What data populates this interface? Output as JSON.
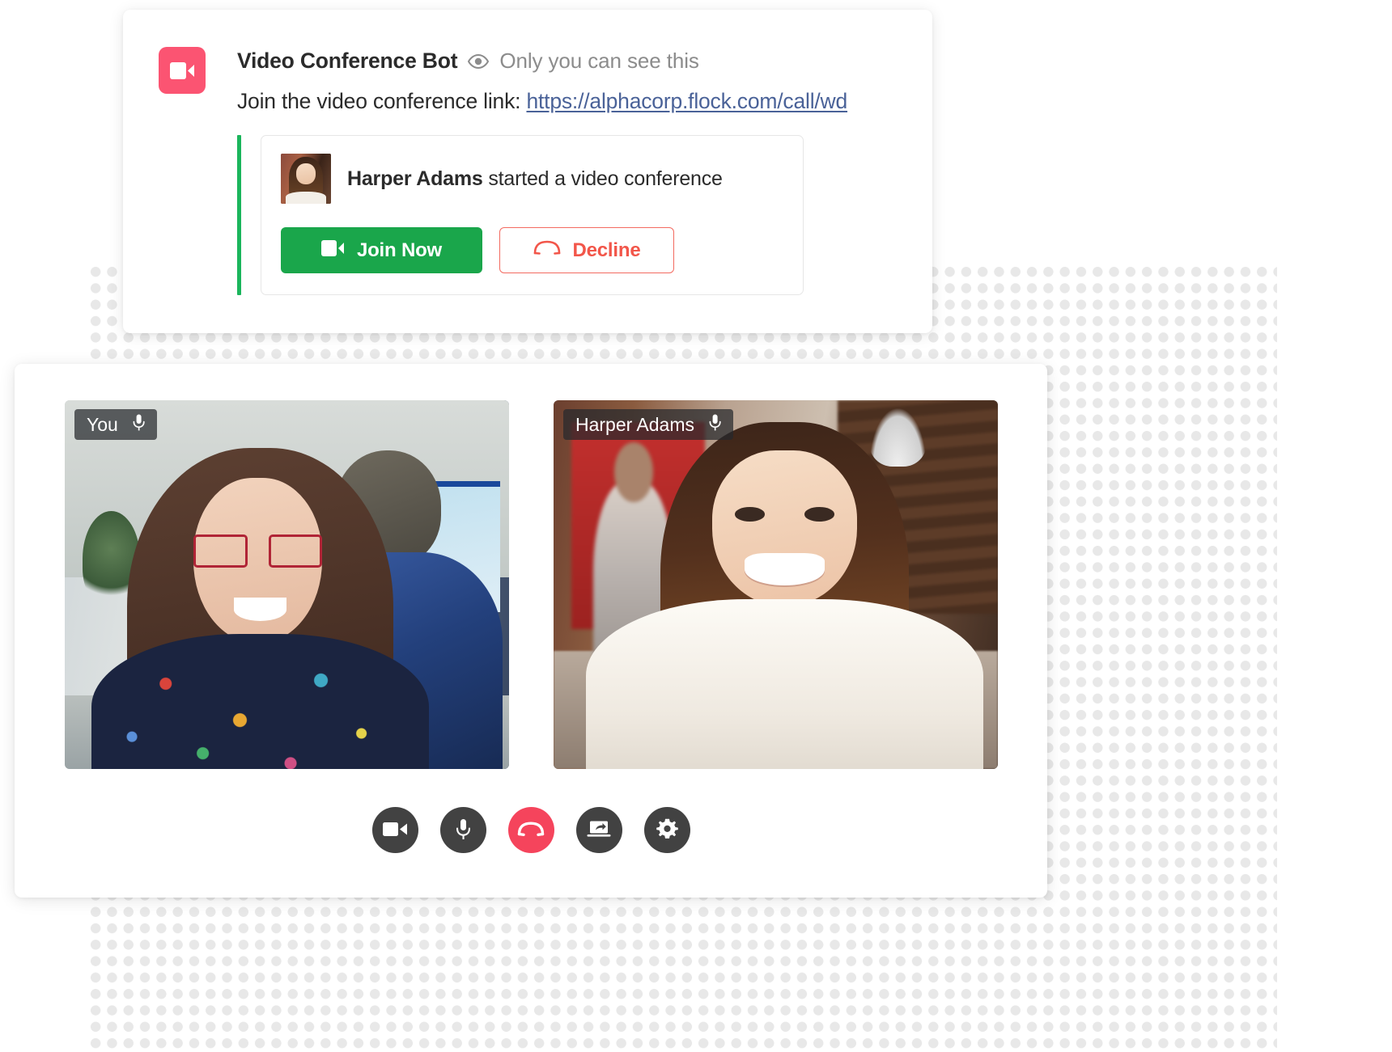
{
  "message_card": {
    "bot_avatar_icon": "video-camera-icon",
    "bot_name": "Video Conference Bot",
    "visibility_icon": "eye-icon",
    "visibility_note": "Only you can see this",
    "join_prefix": "Join the video conference link: ",
    "join_link_text": "https://alphacorp.flock.com/call/wd",
    "accent_bar_color": "#1bb55c",
    "bot_avatar_color": "#fb5472",
    "link_color": "#4a6298"
  },
  "invite": {
    "avatar_name": "harper-adams-thumbnail",
    "actor": "Harper Adams",
    "action": " started a video conference",
    "join_button": {
      "label": "Join Now",
      "icon": "video-camera-icon",
      "bg_color": "#1aa64b",
      "text_color": "#ffffff"
    },
    "decline_button": {
      "label": "Decline",
      "icon": "phone-hangup-icon",
      "border_color": "#f36a60",
      "text_color": "#f2564a"
    }
  },
  "call_window": {
    "tiles": [
      {
        "name": "You",
        "mic_icon": "microphone-icon",
        "scene": "self-video-feed"
      },
      {
        "name": "Harper Adams",
        "mic_icon": "microphone-icon",
        "scene": "harper-video-feed"
      }
    ],
    "controls": [
      {
        "name": "toggle-camera-button",
        "icon": "video-camera-icon",
        "color": "#424242"
      },
      {
        "name": "toggle-microphone-button",
        "icon": "microphone-icon",
        "color": "#424242"
      },
      {
        "name": "end-call-button",
        "icon": "phone-hangup-icon",
        "color": "#f5445c"
      },
      {
        "name": "share-screen-button",
        "icon": "screen-share-icon",
        "color": "#424242"
      },
      {
        "name": "settings-button",
        "icon": "gear-icon",
        "color": "#424242"
      }
    ]
  }
}
